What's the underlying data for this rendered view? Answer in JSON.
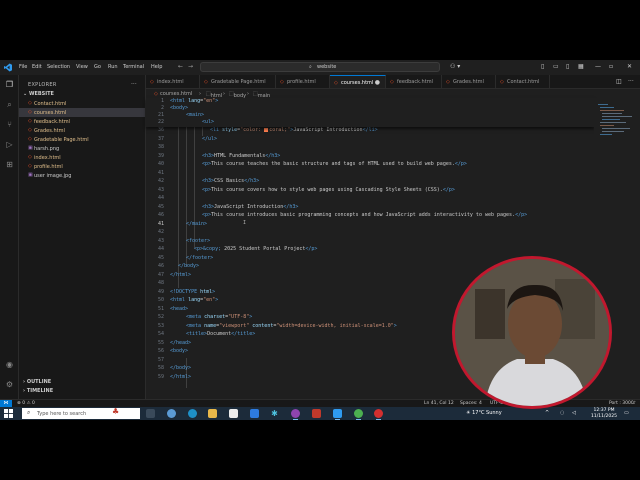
{
  "title_bar": {
    "menu": [
      "File",
      "Edit",
      "Selection",
      "View",
      "Go",
      "Run",
      "Terminal",
      "Help"
    ],
    "search_text": "website"
  },
  "sidebar": {
    "title": "EXPLORER",
    "folder": "WEBSITE",
    "files": [
      {
        "name": "Contact.html",
        "type": "html"
      },
      {
        "name": "courses.html",
        "type": "html",
        "active": true
      },
      {
        "name": "feedback.html",
        "type": "html"
      },
      {
        "name": "Grades.html",
        "type": "html"
      },
      {
        "name": "Gradetable Page.html",
        "type": "html"
      },
      {
        "name": "harsh.png",
        "type": "image"
      },
      {
        "name": "index.html",
        "type": "html"
      },
      {
        "name": "profile.html",
        "type": "html"
      },
      {
        "name": "user image.jpg",
        "type": "image"
      }
    ],
    "outline_label": "OUTLINE",
    "timeline_label": "TIMELINE"
  },
  "tabs": [
    {
      "label": "index.html"
    },
    {
      "label": "Gradetable Page.html"
    },
    {
      "label": "profile.html"
    },
    {
      "label": "courses.html",
      "active": true
    },
    {
      "label": "feedback.html"
    },
    {
      "label": "Grades.html"
    },
    {
      "label": "Contact.html"
    }
  ],
  "breadcrumb": {
    "file": "courses.html",
    "parts": [
      "html",
      "body",
      "main"
    ]
  },
  "editor": {
    "current_line": "41",
    "sticky": [
      {
        "n": "1",
        "code": "<html lang=\"en\">"
      },
      {
        "n": "2",
        "code": "<body>"
      },
      {
        "n": "21",
        "code": "<main>"
      },
      {
        "n": "22",
        "code": "<ul>"
      }
    ],
    "lines": [
      {
        "n": "36",
        "code": "<li style=\"color: ■coral;\">JavaScript Introduction</li>"
      },
      {
        "n": "37",
        "code": "</ul>"
      },
      {
        "n": "38",
        "code": ""
      },
      {
        "n": "39",
        "code": "<h3>HTML Fundamentals</h3>"
      },
      {
        "n": "40",
        "code": "<p>This course teaches the basic structure and tags of HTML used to build web pages.</p>"
      },
      {
        "n": "41",
        "code": ""
      },
      {
        "n": "42",
        "code": "<h3>CSS Basics</h3>"
      },
      {
        "n": "43",
        "code": "<p>This course covers how to style web pages using Cascading Style Sheets (CSS).</p>"
      },
      {
        "n": "44",
        "code": ""
      },
      {
        "n": "45",
        "code": "<h3>JavaScript Introduction</h3>"
      },
      {
        "n": "46",
        "code": "<p>This course introduces basic programming concepts and how JavaScript adds interactivity to web pages.</p>"
      },
      {
        "n": "41",
        "code": "</main>"
      },
      {
        "n": "42",
        "code": ""
      },
      {
        "n": "43",
        "code": "<footer>"
      },
      {
        "n": "44",
        "code": "<p>&copy; 2025 Student Portal Project</p>"
      },
      {
        "n": "45",
        "code": "</footer>"
      },
      {
        "n": "46",
        "code": "</body>"
      },
      {
        "n": "47",
        "code": "</html>"
      },
      {
        "n": "48",
        "code": ""
      },
      {
        "n": "49",
        "code": "<!DOCTYPE html>"
      },
      {
        "n": "50",
        "code": "<html lang=\"en\">"
      },
      {
        "n": "51",
        "code": "<head>"
      },
      {
        "n": "52",
        "code": "<meta charset=\"UTF-8\">"
      },
      {
        "n": "53",
        "code": "<meta name=\"viewport\" content=\"width=device-width, initial-scale=1.0\">"
      },
      {
        "n": "54",
        "code": "<title>Document</title>"
      },
      {
        "n": "55",
        "code": "</head>"
      },
      {
        "n": "56",
        "code": "<body>"
      },
      {
        "n": "57",
        "code": ""
      },
      {
        "n": "58",
        "code": "</body>"
      },
      {
        "n": "59",
        "code": "</html>"
      }
    ]
  },
  "status_bar": {
    "position": "Ln 41, Col 12",
    "spaces": "Spaces: 4",
    "encoding": "UTF-8",
    "port": "Port : 3000"
  },
  "taskbar": {
    "search_placeholder": "Type here to search",
    "weather": "17°C  Sunny",
    "time": "12:37 PM",
    "date": "11/11/2025"
  },
  "colors": {
    "accent": "#0078d4",
    "webcam_border": "#c1182e"
  }
}
